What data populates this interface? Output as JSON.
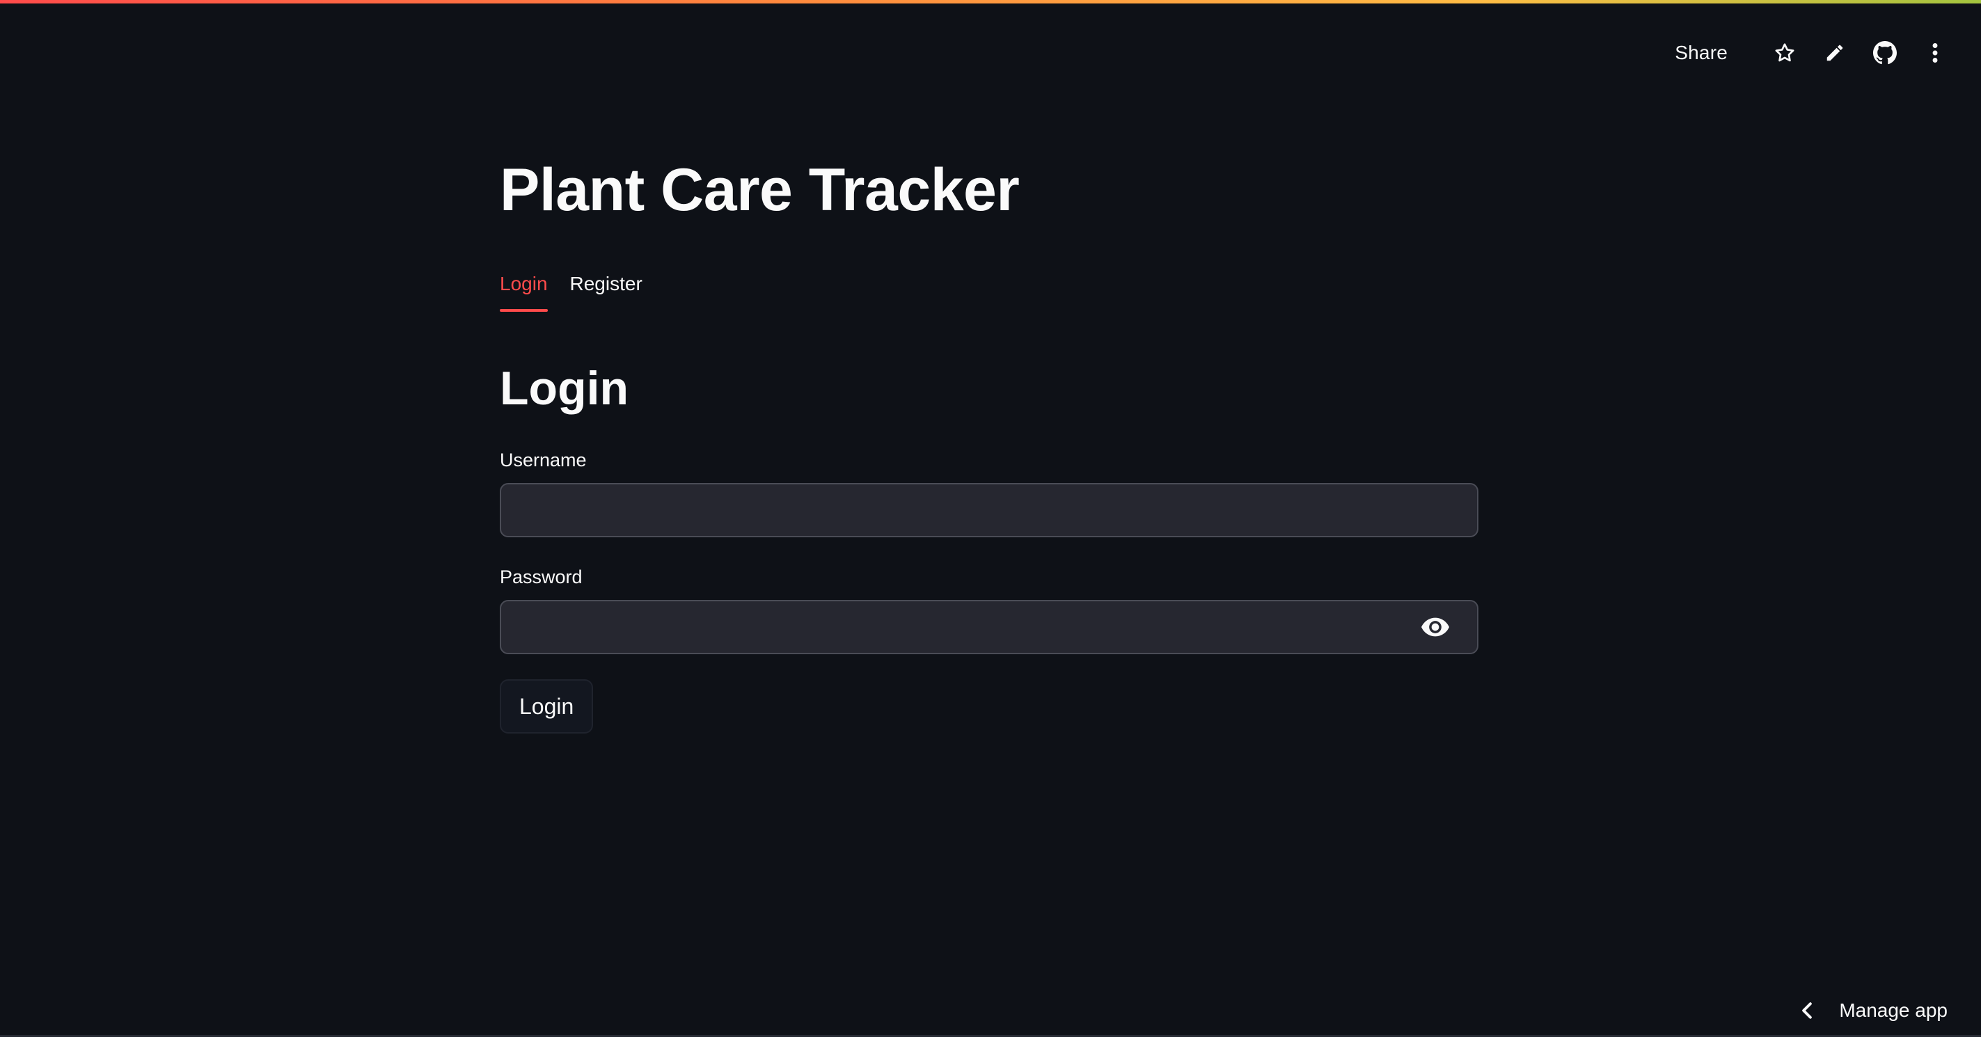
{
  "app": {
    "title": "Plant Care Tracker"
  },
  "toolbar": {
    "share_label": "Share",
    "icons": [
      "star-icon",
      "pencil-icon",
      "github-icon",
      "more-vertical-icon"
    ]
  },
  "tabs": [
    {
      "label": "Login",
      "active": true
    },
    {
      "label": "Register",
      "active": false
    }
  ],
  "login_form": {
    "heading": "Login",
    "username": {
      "label": "Username",
      "value": ""
    },
    "password": {
      "label": "Password",
      "value": "",
      "toggle_icon": "eye-icon"
    },
    "submit_label": "Login"
  },
  "footer": {
    "manage_app_label": "Manage app",
    "manage_app_icon": "chevron-left-icon"
  },
  "colors": {
    "background": "#0e1117",
    "accent": "#ff4b4b",
    "input_background": "#262730",
    "text": "#fafafa"
  }
}
